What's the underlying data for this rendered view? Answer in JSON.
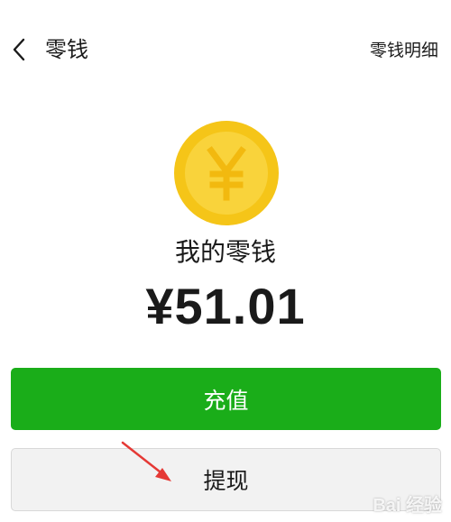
{
  "nav": {
    "title": "零钱",
    "detail_link": "零钱明细",
    "back_icon": "chevron-left-icon"
  },
  "balance": {
    "coin_icon": "yuan-coin-icon",
    "coin_symbol": "¥",
    "label": "我的零钱",
    "amount": "¥51.01"
  },
  "actions": {
    "recharge_label": "充值",
    "withdraw_label": "提现"
  },
  "colors": {
    "primary_green": "#1aad19",
    "coin_outer": "#f5c518",
    "coin_inner": "#f9d33b",
    "arrow_red": "#e53935"
  },
  "watermark": {
    "text": "Bai 经验"
  }
}
